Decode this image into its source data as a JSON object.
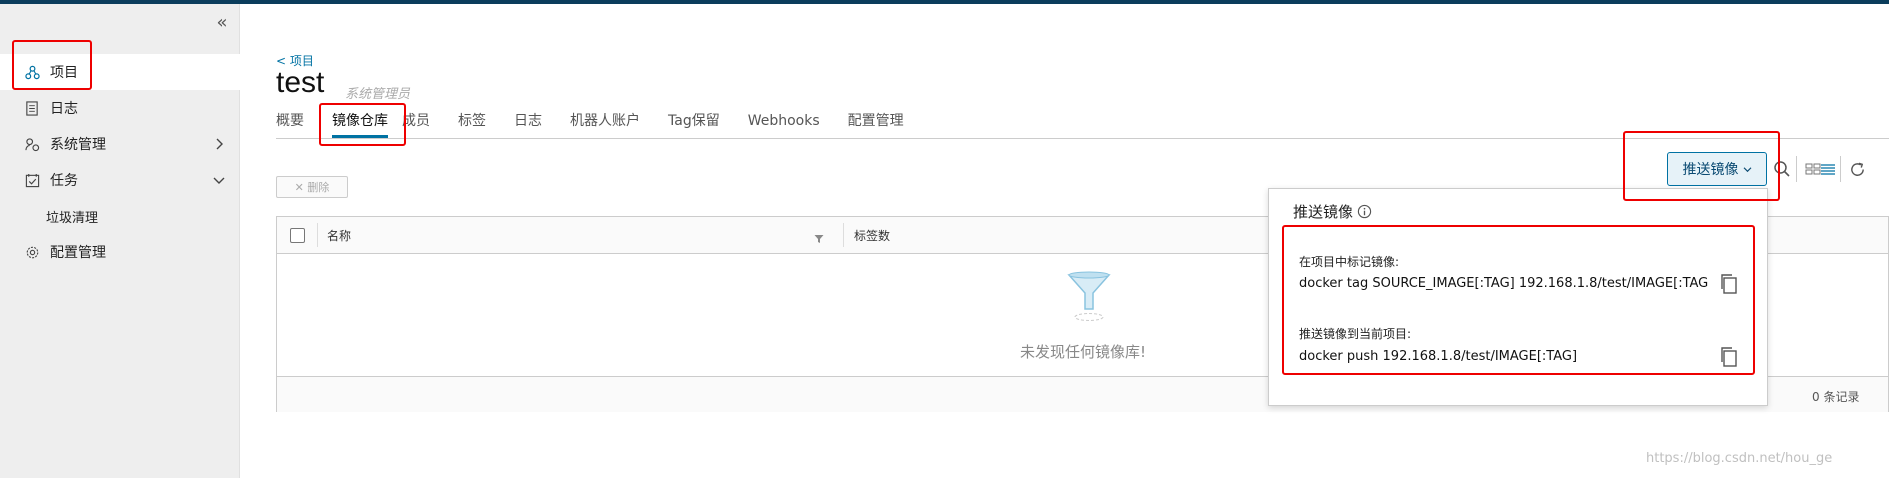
{
  "sidebar": {
    "collapse_icon": "double-chevron-left-icon",
    "items": [
      {
        "label": "项目",
        "icon": "project-icon",
        "active": true
      },
      {
        "label": "日志",
        "icon": "log-icon"
      },
      {
        "label": "系统管理",
        "icon": "users-icon",
        "chevron": "chevron-right-icon"
      },
      {
        "label": "任务",
        "icon": "task-icon",
        "chevron": "chevron-down-icon"
      },
      {
        "label": "垃圾清理",
        "sub": true
      },
      {
        "label": "配置管理",
        "icon": "gear-icon"
      }
    ]
  },
  "header": {
    "breadcrumb": "< 项目",
    "title": "test",
    "role": "系统管理员"
  },
  "tabs": [
    {
      "label": "概要"
    },
    {
      "label": "镜像仓库",
      "active": true
    },
    {
      "label": "成员"
    },
    {
      "label": "标签"
    },
    {
      "label": "日志"
    },
    {
      "label": "机器人账户"
    },
    {
      "label": "Tag保留"
    },
    {
      "label": "Webhooks"
    },
    {
      "label": "配置管理"
    }
  ],
  "toolbar": {
    "delete_label": "✕ 删除",
    "push_label": "推送镜像"
  },
  "table": {
    "columns": [
      "名称",
      "标签数"
    ],
    "empty_text": "未发现任何镜像库!",
    "record_count": "0 条记录"
  },
  "popover": {
    "title": "推送镜像",
    "tag_label": "在项目中标记镜像:",
    "tag_command": "docker tag SOURCE_IMAGE[:TAG] 192.168.1.8/test/IMAGE[:TAG]",
    "push_label": "推送镜像到当前项目:",
    "push_command": "docker push 192.168.1.8/test/IMAGE[:TAG]"
  },
  "watermark": "https://blog.csdn.net/hou_ge",
  "colors": {
    "accent": "#0072a3",
    "highlight": "#ee0000",
    "topbar": "#0b3d5c"
  }
}
